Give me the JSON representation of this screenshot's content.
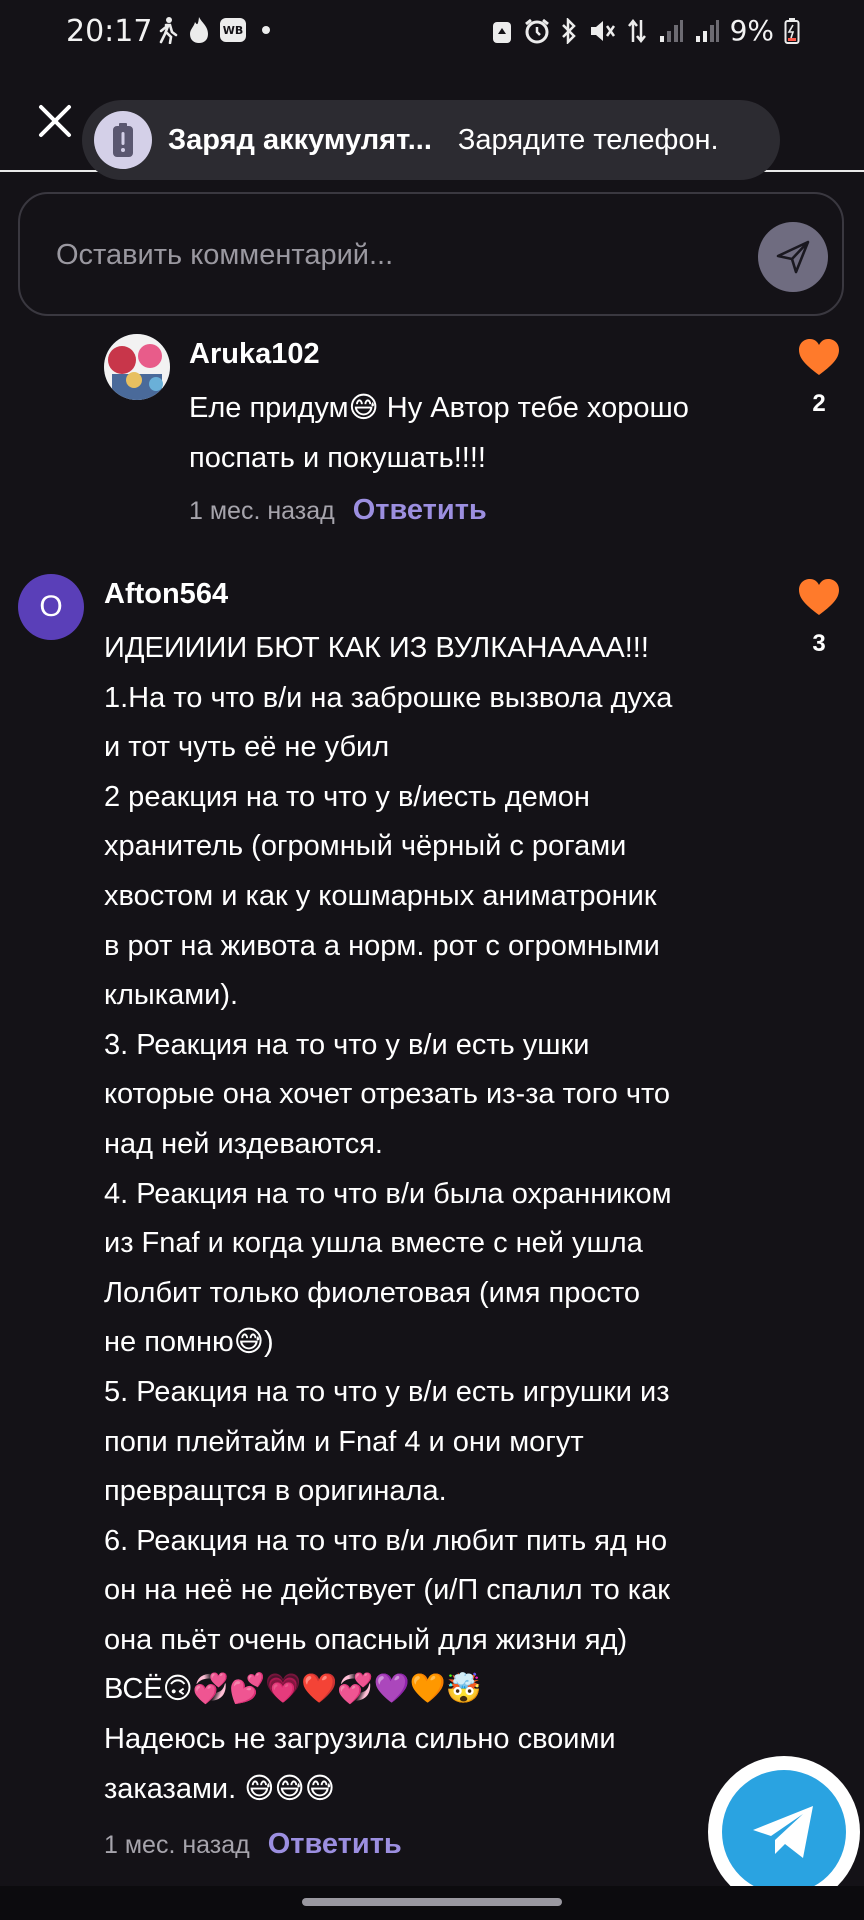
{
  "status_bar": {
    "time": "20:17",
    "wb_badge": "WB",
    "battery": "9%",
    "icons": [
      "walking-icon",
      "fire-icon",
      "wb-app-icon",
      "notification-dot",
      "recycle-icon",
      "alarm-icon",
      "bluetooth-icon",
      "mute-icon",
      "data-arrows-icon",
      "signal-icon",
      "signal-icon-2",
      "battery-icon"
    ]
  },
  "toast": {
    "title": "Заряд аккумулят...",
    "text": "Зарядите телефон."
  },
  "comment_input": {
    "placeholder": "Оставить комментарий..."
  },
  "comments": [
    {
      "user": "Aruka102",
      "text": "Еле придум😅 Ну Автор тебе хорошо\nпоспать и покушать!!!!",
      "time": "1 мес. назад",
      "reply": "Ответить",
      "likes": "2"
    },
    {
      "avatar_letter": "O",
      "user": "Afton564",
      "text": "ИДЕИИИИ БЮТ КАК ИЗ ВУЛКАНАААА!!!\n1.На то что в/и на заброшке вызвола духа\nи тот чуть её не убил\n2 реакция на то что у в/иесть демон\nхранитель (огромный чёрный с рогами\nхвостом и как у кошмарных аниматроник\nв рот на живота а норм. рот с огромными\nклыками).\n3. Реакция на то что у в/и есть ушки\nкоторые она хочет отрезать из-за того что\nнад ней издеваются.\n4. Реакция на то что в/и была охранником\nиз Fnaf и когда ушла вместе с ней ушла\nЛолбит только фиолетовая (имя просто\nне помню😅)\n5. Реакция на то что у в/и есть игрушки из\nпопи плейтайм и Fnaf 4 и они  могут\nпревращтся в оригинала.\n6. Реакция на то что в/и любит пить яд но\nон на неё не действует (и/П спалил то как\nона пьёт очень опасный для жизни яд)\nВСЁ🙃💞💕💗❤️💞💜🧡🤯\nНадеюсь не загрузила сильно своими\nзаказами. 😅😅😅",
      "time": "1 мес. назад",
      "reply": "Ответить",
      "likes": "3"
    }
  ],
  "colors": {
    "background": "#141217",
    "accent": "#9c8fe0",
    "like": "#ff7a2b",
    "avatar": "#5a3fb8",
    "telegram": "#2aa3e1"
  }
}
